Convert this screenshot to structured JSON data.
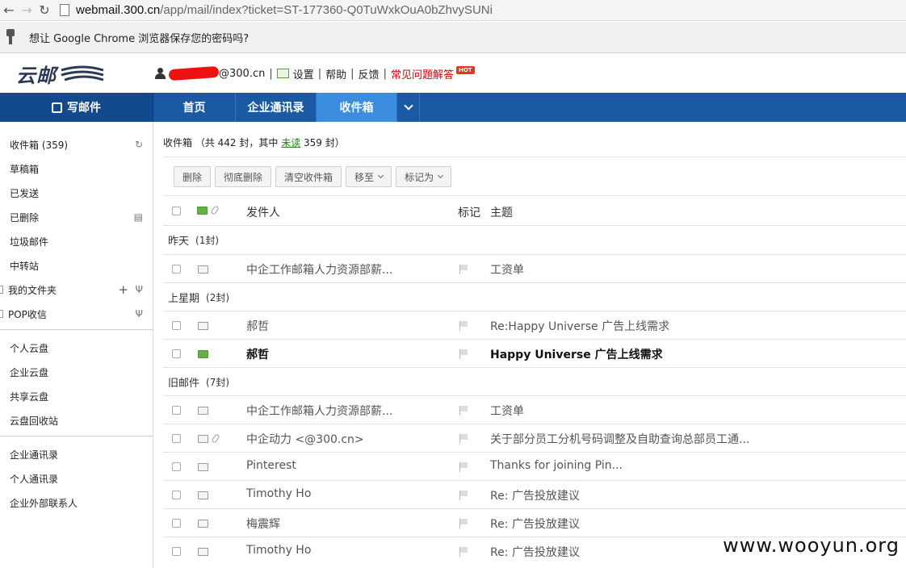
{
  "browser": {
    "url_host": "webmail.300.cn",
    "url_path": "/app/mail/index?ticket=ST-177360-Q0TuWxkOuA0bZhvySUNi",
    "password_prompt": "想让 Google Chrome 浏览器保存您的密码吗?"
  },
  "header": {
    "logo_text": "云邮",
    "user_email_suffix": "@300.cn",
    "links": {
      "settings": "设置",
      "help": "帮助",
      "feedback": "反馈",
      "faq": "常见问题解答",
      "hot": "HOT"
    }
  },
  "topnav": {
    "compose": "写邮件",
    "tabs": [
      {
        "label": "首页"
      },
      {
        "label": "企业通讯录"
      },
      {
        "label": "收件箱"
      }
    ]
  },
  "sidebar": {
    "folders": [
      {
        "label": "收件箱 (359)"
      },
      {
        "label": "草稿箱"
      },
      {
        "label": "已发送"
      },
      {
        "label": "已删除"
      },
      {
        "label": "垃圾邮件"
      },
      {
        "label": "中转站"
      },
      {
        "label": "我的文件夹"
      },
      {
        "label": "POP收信"
      }
    ],
    "cloud": [
      {
        "label": "个人云盘"
      },
      {
        "label": "企业云盘"
      },
      {
        "label": "共享云盘"
      },
      {
        "label": "云盘回收站"
      }
    ],
    "contacts": [
      {
        "label": "企业通讯录"
      },
      {
        "label": "个人通讯录"
      },
      {
        "label": "企业外部联系人"
      }
    ]
  },
  "mailbox": {
    "summary_prefix": "收件箱 （共 442 封，其中",
    "summary_unread": "未读",
    "summary_suffix": "359 封）",
    "toolbar": {
      "delete": "删除",
      "delete_permanent": "彻底删除",
      "empty_inbox": "清空收件箱",
      "move_to": "移至",
      "mark_as": "标记为"
    },
    "columns": {
      "sender": "发件人",
      "flag": "标记",
      "subject": "主题"
    },
    "groups": [
      {
        "label": "昨天",
        "count": "(1封)"
      },
      {
        "label": "上星期",
        "count": "(2封)"
      },
      {
        "label": "旧邮件",
        "count": "(7封)"
      }
    ],
    "rows": [
      {
        "sender": "中企工作邮箱人力资源部薪...",
        "subject": "工资单"
      },
      {
        "sender": "郝哲",
        "subject": "Re:Happy Universe 广告上线需求"
      },
      {
        "sender": "郝哲",
        "subject": "Happy Universe 广告上线需求"
      },
      {
        "sender": "中企工作邮箱人力资源部薪...",
        "subject": "工资单"
      },
      {
        "sender": "中企动力 <@300.cn>",
        "subject": "关于部分员工分机号码调整及自助查询总部员工通..."
      },
      {
        "sender": "Pinterest",
        "subject": "Thanks for joining Pin..."
      },
      {
        "sender": "Timothy Ho",
        "subject": "Re: 广告投放建议"
      },
      {
        "sender": "梅震辉",
        "subject": "Re: 广告投放建议"
      },
      {
        "sender": "Timothy Ho",
        "subject": "Re: 广告投放建议"
      }
    ]
  },
  "watermark": "www.wooyun.org",
  "colors": {
    "nav_blue": "#1a5aa5",
    "active_tab": "#3b8de0",
    "faq_red": "#d40000",
    "unread_green": "#2a7d20"
  }
}
